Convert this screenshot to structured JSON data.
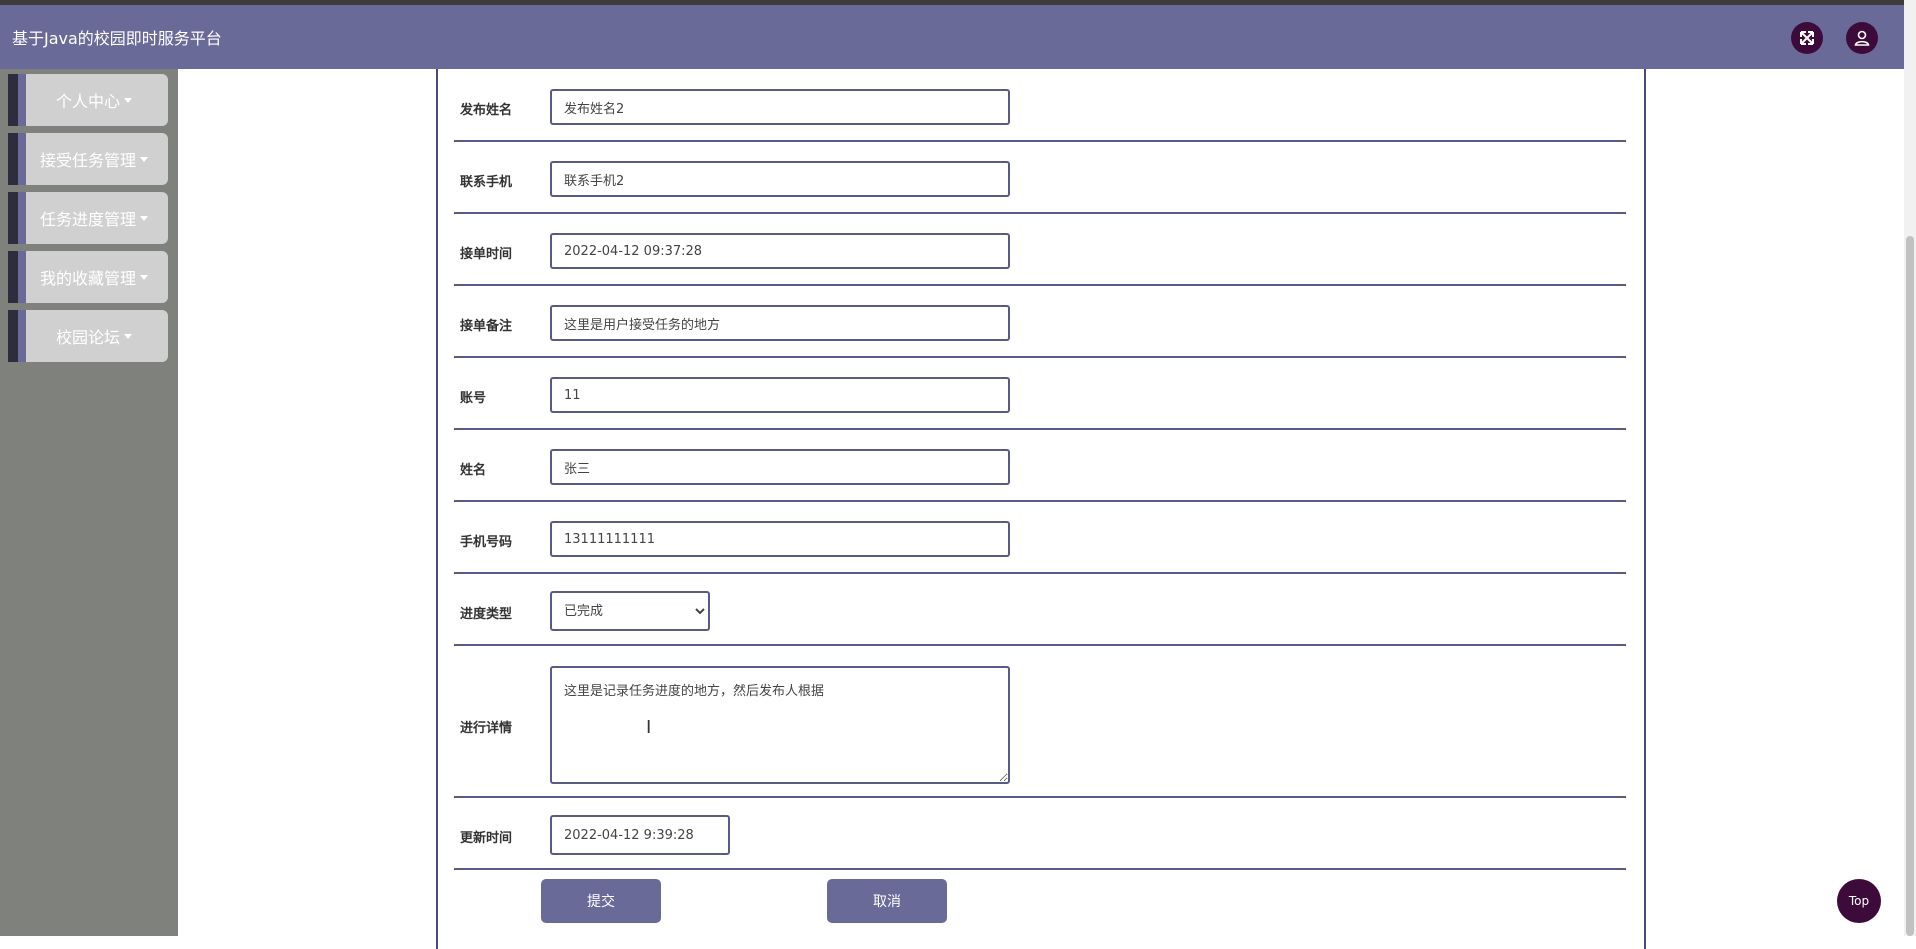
{
  "header": {
    "title": "基于Java的校园即时服务平台",
    "bg_color": "#6a6a99",
    "icons": [
      "fullscreen-icon",
      "user-icon"
    ]
  },
  "sidebar": {
    "items": [
      {
        "label": "个人中心"
      },
      {
        "label": "接受任务管理"
      },
      {
        "label": "任务进度管理"
      },
      {
        "label": "我的收藏管理"
      },
      {
        "label": "校园论坛"
      }
    ]
  },
  "form": {
    "fields": [
      {
        "label": "发布姓名",
        "value": "发布姓名2"
      },
      {
        "label": "联系手机",
        "value": "联系手机2"
      },
      {
        "label": "接单时间",
        "value": "2022-04-12 09:37:28"
      },
      {
        "label": "接单备注",
        "value": "这里是用户接受任务的地方"
      },
      {
        "label": "账号",
        "value": "11"
      },
      {
        "label": "姓名",
        "value": "张三"
      },
      {
        "label": "手机号码",
        "value": "13111111111"
      }
    ],
    "progress_type": {
      "label": "进度类型",
      "selected": "已完成"
    },
    "detail": {
      "label": "进行详情",
      "value": "这里是记录任务进度的地方，然后发布人根据"
    },
    "update_time": {
      "label": "更新时间",
      "value": "2022-04-12 9:39:28"
    },
    "submit_label": "提交",
    "cancel_label": "取消"
  },
  "top_button": {
    "label": "Top"
  }
}
